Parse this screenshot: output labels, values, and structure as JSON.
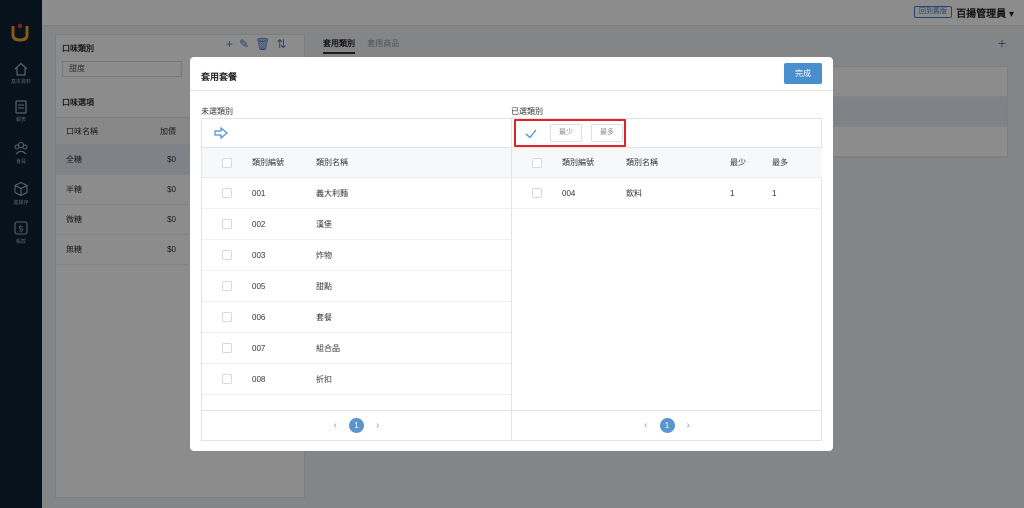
{
  "sidebar": {
    "items": [
      {
        "label": "基本資料",
        "icon": "home-icon"
      },
      {
        "label": "報表",
        "icon": "report-icon"
      },
      {
        "label": "會員",
        "icon": "members-icon"
      },
      {
        "label": "進銷存",
        "icon": "inventory-icon"
      },
      {
        "label": "帳款",
        "icon": "dollar-icon"
      }
    ]
  },
  "topbar": {
    "back_label": "回到舊版",
    "user_label": "百揚管理員 ▾"
  },
  "background": {
    "flavor_category_label": "口味類別",
    "flavor_select_value": "甜度",
    "flavor_options_label": "口味選項",
    "columns": [
      "口味名稱",
      "加價"
    ],
    "options": [
      {
        "name": "全糖",
        "price": "$0"
      },
      {
        "name": "半糖",
        "price": "$0"
      },
      {
        "name": "微糖",
        "price": "$0"
      },
      {
        "name": "無糖",
        "price": "$0"
      }
    ],
    "tabs": [
      "套用類別",
      "套用商品"
    ]
  },
  "modal": {
    "title": "套用套餐",
    "done_label": "完成",
    "unselected_label": "未選類別",
    "selected_label": "已選類別",
    "columns": {
      "code": "類別編號",
      "name": "類別名稱",
      "min": "最少",
      "max": "最多"
    },
    "min_button_label": "最少",
    "max_button_label": "最多",
    "unselected_rows": [
      {
        "code": "001",
        "name": "義大利麵"
      },
      {
        "code": "002",
        "name": "漢堡"
      },
      {
        "code": "003",
        "name": "炸物"
      },
      {
        "code": "005",
        "name": "甜點"
      },
      {
        "code": "006",
        "name": "套餐"
      },
      {
        "code": "007",
        "name": "組合品"
      },
      {
        "code": "008",
        "name": "折扣"
      }
    ],
    "selected_rows": [
      {
        "code": "004",
        "name": "飲料",
        "min": "1",
        "max": "1"
      }
    ],
    "page": "1",
    "prev_arrow": "‹",
    "next_arrow": "›"
  },
  "colors": {
    "sidebar_bg": "#0d2233",
    "primary": "#4a8fcd",
    "highlight": "#e0222a"
  }
}
